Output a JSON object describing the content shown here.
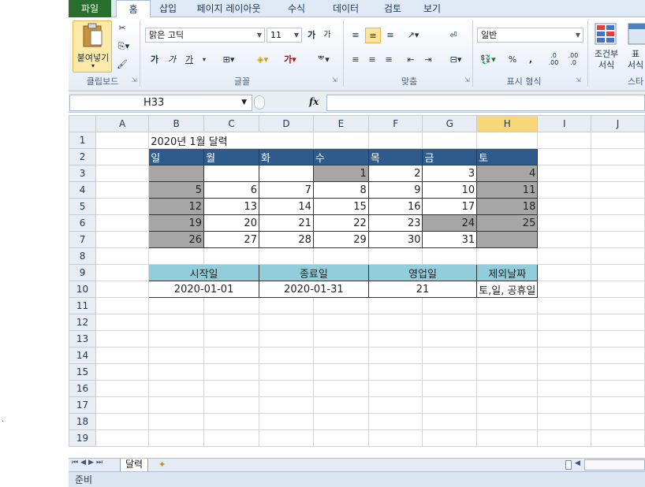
{
  "tabs": [
    {
      "label": "파일",
      "type": "file"
    },
    {
      "label": "홈",
      "type": "active"
    },
    {
      "label": "삽입"
    },
    {
      "label": "페이지 레이아웃"
    },
    {
      "label": "수식"
    },
    {
      "label": "데이터"
    },
    {
      "label": "검토"
    },
    {
      "label": "보기"
    }
  ],
  "ribbon": {
    "clipboard": {
      "paste_label": "붙여넣기",
      "group_label": "클립보드"
    },
    "font": {
      "font_name": "맑은 고딕",
      "font_size": "11",
      "group_label": "글꼴",
      "bold": "가",
      "italic": "가",
      "underline": "가",
      "grow": "가",
      "shrink": "가"
    },
    "alignment": {
      "group_label": "맞춤"
    },
    "number": {
      "format": "일반",
      "percent": "%",
      "comma": ",",
      "inc_decimal": ".0 .00",
      "dec_decimal": ".00 .0",
      "group_label": "표시 형식"
    },
    "styles": {
      "cond_format_line1": "조건부",
      "cond_format_line2": "서식",
      "table_line1": "표",
      "table_line2": "서식",
      "group_label": "스타"
    }
  },
  "formula_bar": {
    "name_box": "H33",
    "fx": "fx",
    "value": ""
  },
  "columns": [
    "A",
    "B",
    "C",
    "D",
    "E",
    "F",
    "G",
    "H",
    "I",
    "J"
  ],
  "selected_column": "H",
  "rows": [
    "1",
    "2",
    "3",
    "4",
    "5",
    "6",
    "7",
    "8",
    "9",
    "10",
    "11",
    "12",
    "13",
    "14",
    "15",
    "16",
    "17",
    "18",
    "19"
  ],
  "sheet": {
    "title": "2020년 1월 달력",
    "weekdays": [
      "일",
      "월",
      "화",
      "수",
      "목",
      "금",
      "토"
    ],
    "weeks": [
      [
        "",
        "",
        "",
        "1",
        "2",
        "3",
        "4"
      ],
      [
        "5",
        "6",
        "7",
        "8",
        "9",
        "10",
        "11"
      ],
      [
        "12",
        "13",
        "14",
        "15",
        "16",
        "17",
        "18"
      ],
      [
        "19",
        "20",
        "21",
        "22",
        "23",
        "24",
        "25"
      ],
      [
        "26",
        "27",
        "28",
        "29",
        "30",
        "31",
        ""
      ]
    ],
    "gray_cells": [
      [
        true,
        false,
        false,
        true,
        false,
        false,
        true
      ],
      [
        true,
        false,
        false,
        false,
        false,
        false,
        true
      ],
      [
        true,
        false,
        false,
        false,
        false,
        false,
        true
      ],
      [
        true,
        false,
        false,
        false,
        false,
        true,
        true
      ],
      [
        true,
        false,
        false,
        false,
        false,
        false,
        true
      ]
    ],
    "info_headers": [
      "시작일",
      "종료일",
      "영업일",
      "제외날짜"
    ],
    "info_values": [
      "2020-01-01",
      "2020-01-31",
      "21",
      "토,일, 공휴일"
    ]
  },
  "sheet_tabs": [
    {
      "label": "달력"
    }
  ],
  "status": "준비",
  "colors": {
    "header_blue": "#2f5a8c",
    "gray": "#a6a6a6",
    "info_header": "#92cddc",
    "selected_col": "#f7d77a"
  }
}
